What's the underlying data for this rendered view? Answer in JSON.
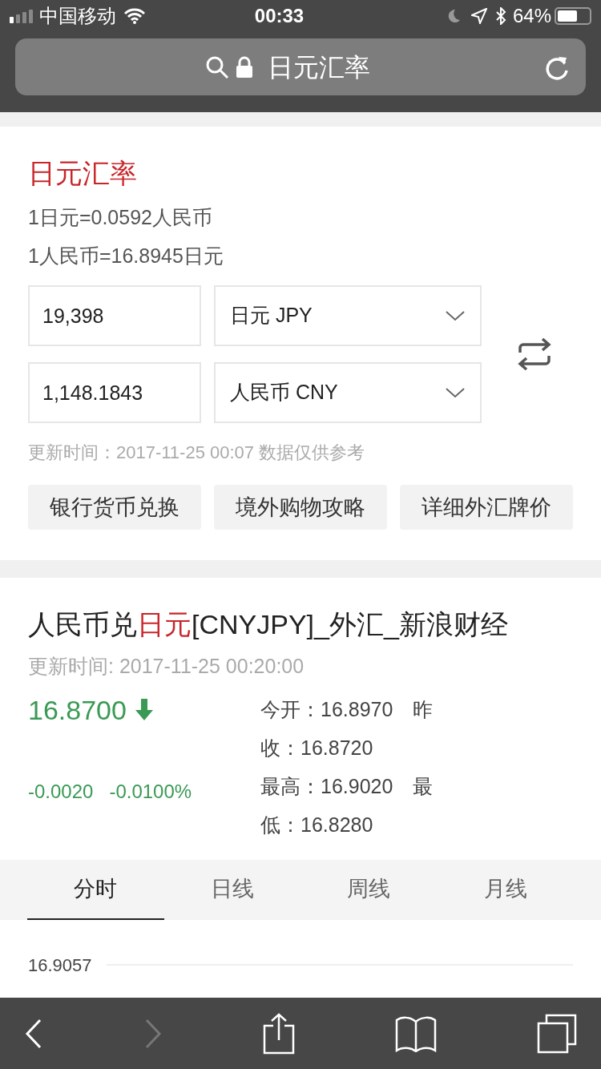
{
  "status_bar": {
    "carrier": "中国移动",
    "time": "00:33",
    "battery": "64%"
  },
  "address_bar": {
    "title": "日元汇率"
  },
  "converter": {
    "title": "日元汇率",
    "rates": [
      "1日元=0.0592人民币",
      "1人民币=16.8945日元"
    ],
    "rows": [
      {
        "amount": "19,398",
        "currency": "日元 JPY"
      },
      {
        "amount": "1,148.1843",
        "currency": "人民币 CNY"
      }
    ],
    "note": "更新时间：2017-11-25 00:07 数据仅供参考",
    "buttons": [
      "银行货币兑换",
      "境外购物攻略",
      "详细外汇牌价"
    ]
  },
  "quote": {
    "title_parts": [
      {
        "text": "人民币兑",
        "highlight": false
      },
      {
        "text": "日元",
        "highlight": true
      },
      {
        "text": "[CNYJPY]_外汇_新浪财经",
        "highlight": false
      }
    ],
    "updated": "更新时间: 2017-11-25 00:20:00",
    "price": "16.8700",
    "change": "-0.0020",
    "change_pct": "-0.0100%",
    "stats": [
      "今开：16.8970　昨",
      "收：16.8720",
      "最高：16.9020　最",
      "低：16.8280"
    ]
  },
  "tabs": [
    {
      "label": "分时",
      "selected": true
    },
    {
      "label": "日线",
      "selected": false
    },
    {
      "label": "周线",
      "selected": false
    },
    {
      "label": "月线",
      "selected": false
    }
  ],
  "chart": {
    "top_label": "16.9057"
  }
}
